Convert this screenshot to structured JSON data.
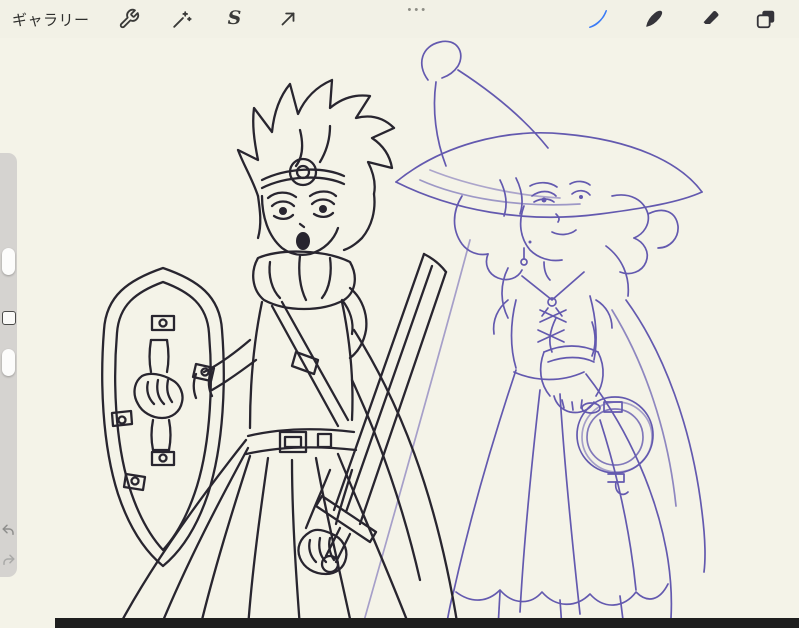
{
  "topbar": {
    "gallery_label": "ギャラリー",
    "drag_handle_dots": "•••",
    "left_tools": [
      {
        "name": "wrench-icon"
      },
      {
        "name": "adjustments-wand-icon"
      },
      {
        "name": "selection-s-icon",
        "glyph": "S"
      },
      {
        "name": "transform-arrow-icon"
      }
    ],
    "right_tools": [
      {
        "name": "paint-brush-icon",
        "active": true
      },
      {
        "name": "smudge-icon",
        "active": false
      },
      {
        "name": "eraser-icon",
        "active": false
      },
      {
        "name": "layers-icon",
        "active": false
      }
    ]
  },
  "sidebar": {
    "elements": [
      "brush-size-slider",
      "modify-button",
      "opacity-slider",
      "undo-button",
      "redo-button"
    ]
  },
  "canvas": {
    "background_color": "#f4f3e8",
    "ink_color": "#28252f",
    "sketch_color": "#574caa",
    "artwork": "Line-art of a spiky-haired hero holding a sword and riveted shield, beside a purple pencil sketch of a witch in a wide-brimmed pointed hat holding a round lantern"
  },
  "colors": {
    "topbar_bg": "#f2f1e6",
    "sidebar_bg": "#d1d0cd",
    "bottom_bar": "#1e1e1e",
    "icon": "#3a3a38",
    "accent_blue": "#3a7bf6"
  }
}
